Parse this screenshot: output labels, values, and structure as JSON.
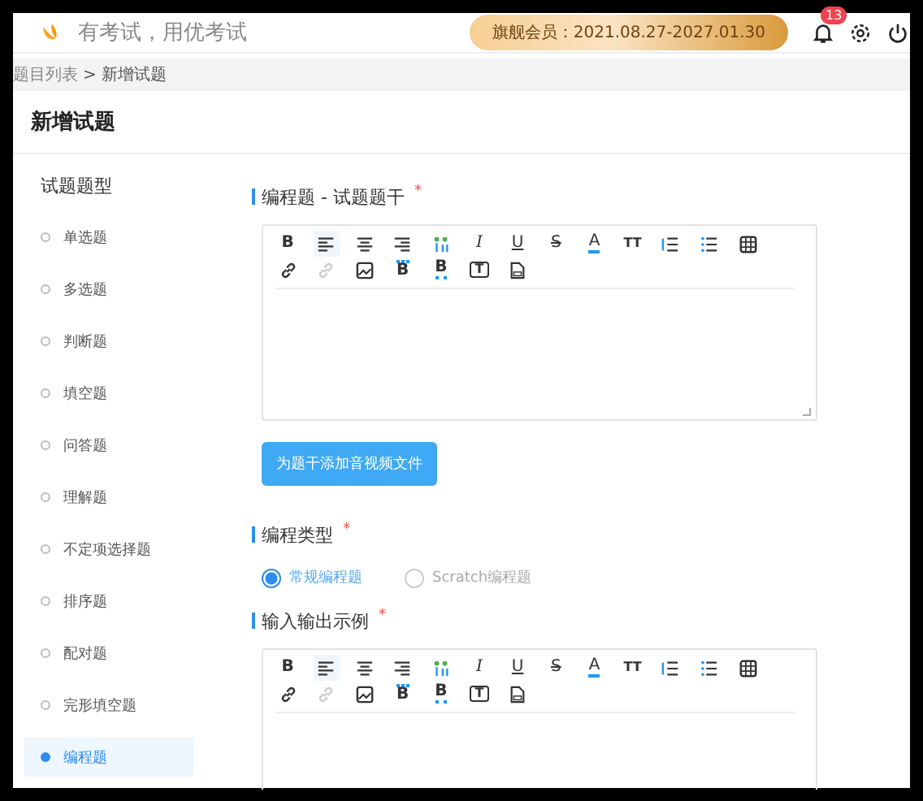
{
  "header": {
    "slogan": "有考试，用优考试",
    "membership": "旗舰会员：2021.08.27-2027.01.30",
    "notification_count": "13"
  },
  "breadcrumb": {
    "parent": "题目列表",
    "separator": ">",
    "current": "新增试题"
  },
  "page_title": "新增试题",
  "sidebar": {
    "title": "试题题型",
    "items": [
      {
        "label": "单选题",
        "selected": false
      },
      {
        "label": "多选题",
        "selected": false
      },
      {
        "label": "判断题",
        "selected": false
      },
      {
        "label": "填空题",
        "selected": false
      },
      {
        "label": "问答题",
        "selected": false
      },
      {
        "label": "理解题",
        "selected": false
      },
      {
        "label": "不定项选择题",
        "selected": false
      },
      {
        "label": "排序题",
        "selected": false
      },
      {
        "label": "配对题",
        "selected": false
      },
      {
        "label": "完形填空题",
        "selected": false
      },
      {
        "label": "编程题",
        "selected": true
      }
    ]
  },
  "sections": [
    {
      "kind": "editor",
      "title": "编程题 - 试题题干",
      "required_mark": "*",
      "upload_button": "为题干添加音视频文件",
      "toolbar": [
        {
          "kind": "bold",
          "glyph": "B",
          "active": false,
          "disabled": false
        },
        {
          "kind": "align-left",
          "active": true,
          "disabled": false
        },
        {
          "kind": "align-center",
          "active": false,
          "disabled": false
        },
        {
          "kind": "align-right",
          "active": false,
          "disabled": false
        },
        {
          "kind": "format-painter",
          "active": false,
          "disabled": false
        },
        {
          "kind": "italic",
          "glyph": "I",
          "active": false,
          "disabled": false
        },
        {
          "kind": "underline",
          "glyph": "U",
          "active": false,
          "disabled": false
        },
        {
          "kind": "strike",
          "glyph": "S",
          "active": false,
          "disabled": false
        },
        {
          "kind": "font-color",
          "glyph": "A",
          "active": false,
          "disabled": false
        },
        {
          "kind": "font-size",
          "glyph": "TT",
          "active": false,
          "disabled": false
        },
        {
          "kind": "ordered-list",
          "active": false,
          "disabled": false
        },
        {
          "kind": "bullet-list",
          "active": false,
          "disabled": false
        },
        {
          "kind": "table",
          "active": false,
          "disabled": false
        },
        {
          "kind": "link",
          "active": false,
          "disabled": false
        },
        {
          "kind": "unlink",
          "active": false,
          "disabled": true
        },
        {
          "kind": "image",
          "active": false,
          "disabled": false
        },
        {
          "kind": "superscript",
          "glyph": "B",
          "active": false,
          "disabled": false
        },
        {
          "kind": "subscript",
          "glyph": "B",
          "active": false,
          "disabled": false
        },
        {
          "kind": "text-box",
          "glyph": "T",
          "active": false,
          "disabled": false
        },
        {
          "kind": "file",
          "active": false,
          "disabled": false
        }
      ]
    },
    {
      "kind": "radio",
      "title": "编程类型",
      "required_mark": "*",
      "options": [
        {
          "label": "常规编程题",
          "selected": true
        },
        {
          "label": "Scratch编程题",
          "selected": false
        }
      ]
    },
    {
      "kind": "editor",
      "title": "输入输出示例",
      "required_mark": "*",
      "toolbar": [
        {
          "kind": "bold",
          "glyph": "B",
          "active": false,
          "disabled": false
        },
        {
          "kind": "align-left",
          "active": true,
          "disabled": false
        },
        {
          "kind": "align-center",
          "active": false,
          "disabled": false
        },
        {
          "kind": "align-right",
          "active": false,
          "disabled": false
        },
        {
          "kind": "format-painter",
          "active": false,
          "disabled": false
        },
        {
          "kind": "italic",
          "glyph": "I",
          "active": false,
          "disabled": false
        },
        {
          "kind": "underline",
          "glyph": "U",
          "active": false,
          "disabled": false
        },
        {
          "kind": "strike",
          "glyph": "S",
          "active": false,
          "disabled": false
        },
        {
          "kind": "font-color",
          "glyph": "A",
          "active": false,
          "disabled": false
        },
        {
          "kind": "font-size",
          "glyph": "TT",
          "active": false,
          "disabled": false
        },
        {
          "kind": "ordered-list",
          "active": false,
          "disabled": false
        },
        {
          "kind": "bullet-list",
          "active": false,
          "disabled": false
        },
        {
          "kind": "table",
          "active": false,
          "disabled": false
        },
        {
          "kind": "link",
          "active": false,
          "disabled": false
        },
        {
          "kind": "unlink",
          "active": false,
          "disabled": true
        },
        {
          "kind": "image",
          "active": false,
          "disabled": false
        },
        {
          "kind": "superscript",
          "glyph": "B",
          "active": false,
          "disabled": false
        },
        {
          "kind": "subscript",
          "glyph": "B",
          "active": false,
          "disabled": false
        },
        {
          "kind": "text-box",
          "glyph": "T",
          "active": false,
          "disabled": false
        },
        {
          "kind": "file",
          "active": false,
          "disabled": false
        }
      ]
    }
  ]
}
